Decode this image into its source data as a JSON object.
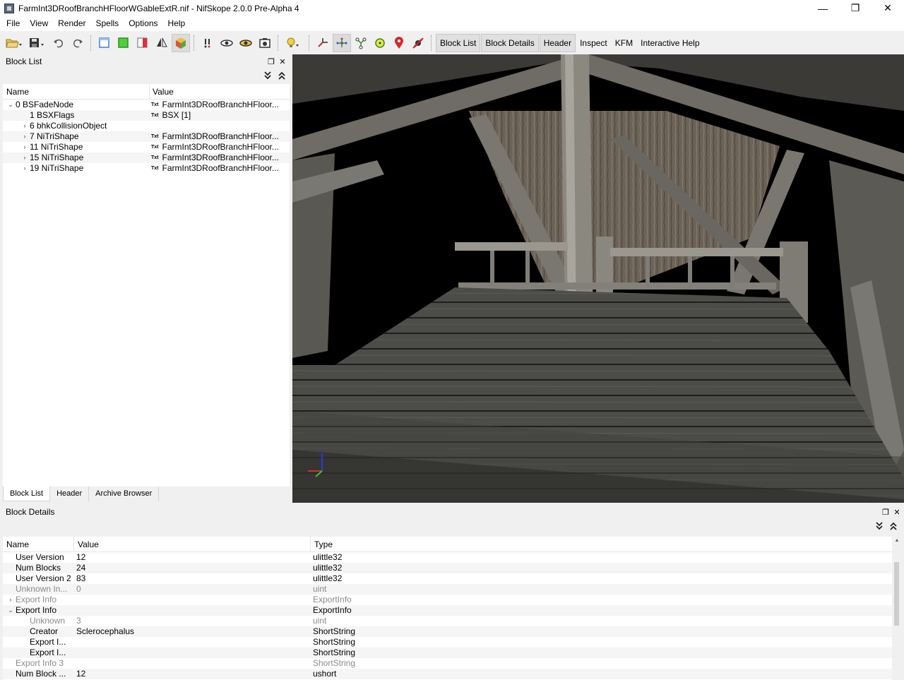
{
  "window": {
    "title": "FarmInt3DRoofBranchHFloorWGableExtR.nif - NifSkope 2.0.0 Pre-Alpha 4",
    "minimize": "—",
    "maximize": "❐",
    "close": "✕"
  },
  "menu": [
    "File",
    "View",
    "Render",
    "Spells",
    "Options",
    "Help"
  ],
  "toolbar": {
    "icons": [
      "open-icon",
      "save-icon",
      "undo-icon",
      "redo-icon",
      "view-front-icon",
      "view-top-icon",
      "view-side-icon",
      "flip-icon",
      "perspective-icon",
      "select-icon",
      "eye-icon",
      "eye-hidden-icon",
      "screenshot-icon",
      "light-icon",
      "axes-icon",
      "nodes-icon",
      "branches-icon",
      "sun-icon",
      "marker-icon",
      "disable-icon"
    ],
    "buttons": [
      "Block List",
      "Block Details",
      "Header",
      "Inspect",
      "KFM",
      "Interactive Help"
    ]
  },
  "block_list": {
    "title": "Block List",
    "expand_all": "⏬",
    "collapse_all": "⏫",
    "columns": [
      "Name",
      "Value"
    ],
    "rows": [
      {
        "chev": "⌄",
        "indent": 0,
        "name": "0 BSFadeNode",
        "tag": "Txt",
        "value": "FarmInt3DRoofBranchHFloor..."
      },
      {
        "chev": "",
        "indent": 1,
        "name": "1 BSXFlags",
        "tag": "Txt",
        "value": "BSX [1]"
      },
      {
        "chev": "›",
        "indent": 1,
        "name": "6 bhkCollisionObject",
        "tag": "",
        "value": ""
      },
      {
        "chev": "›",
        "indent": 1,
        "name": "7 NiTriShape",
        "tag": "Txt",
        "value": "FarmInt3DRoofBranchHFloor..."
      },
      {
        "chev": "›",
        "indent": 1,
        "name": "11 NiTriShape",
        "tag": "Txt",
        "value": "FarmInt3DRoofBranchHFloor..."
      },
      {
        "chev": "›",
        "indent": 1,
        "name": "15 NiTriShape",
        "tag": "Txt",
        "value": "FarmInt3DRoofBranchHFloor..."
      },
      {
        "chev": "›",
        "indent": 1,
        "name": "19 NiTriShape",
        "tag": "Txt",
        "value": "FarmInt3DRoofBranchHFloor..."
      }
    ],
    "tabs": [
      "Block List",
      "Header",
      "Archive Browser"
    ]
  },
  "block_details": {
    "title": "Block Details",
    "columns": [
      "Name",
      "Value",
      "Type"
    ],
    "rows": [
      {
        "chev": "",
        "indent": 1,
        "name": "User Version",
        "value": "12",
        "type": "ulittle32",
        "dim": false
      },
      {
        "chev": "",
        "indent": 1,
        "name": "Num Blocks",
        "value": "24",
        "type": "ulittle32",
        "dim": false
      },
      {
        "chev": "",
        "indent": 1,
        "name": "User Version 2",
        "value": "83",
        "type": "ulittle32",
        "dim": false
      },
      {
        "chev": "",
        "indent": 1,
        "name": "Unknown In...",
        "value": "0",
        "type": "uint",
        "dim": true
      },
      {
        "chev": "›",
        "indent": 1,
        "name": "Export Info",
        "value": "",
        "type": "ExportInfo",
        "dim": true
      },
      {
        "chev": "⌄",
        "indent": 1,
        "name": "Export Info",
        "value": "",
        "type": "ExportInfo",
        "dim": false
      },
      {
        "chev": "",
        "indent": 2,
        "name": "Unknown",
        "value": "3",
        "type": "uint",
        "dim": true
      },
      {
        "chev": "",
        "indent": 2,
        "name": "Creator",
        "value": "Sclerocephalus",
        "type": "ShortString",
        "dim": false
      },
      {
        "chev": "",
        "indent": 2,
        "name": "Export I...",
        "value": "",
        "type": "ShortString",
        "dim": false
      },
      {
        "chev": "",
        "indent": 2,
        "name": "Export I...",
        "value": "",
        "type": "ShortString",
        "dim": false
      },
      {
        "chev": "",
        "indent": 1,
        "name": "Export Info 3",
        "value": "",
        "type": "ShortString",
        "dim": true
      },
      {
        "chev": "",
        "indent": 1,
        "name": "Num Block ...",
        "value": "12",
        "type": "ushort",
        "dim": false
      }
    ]
  }
}
